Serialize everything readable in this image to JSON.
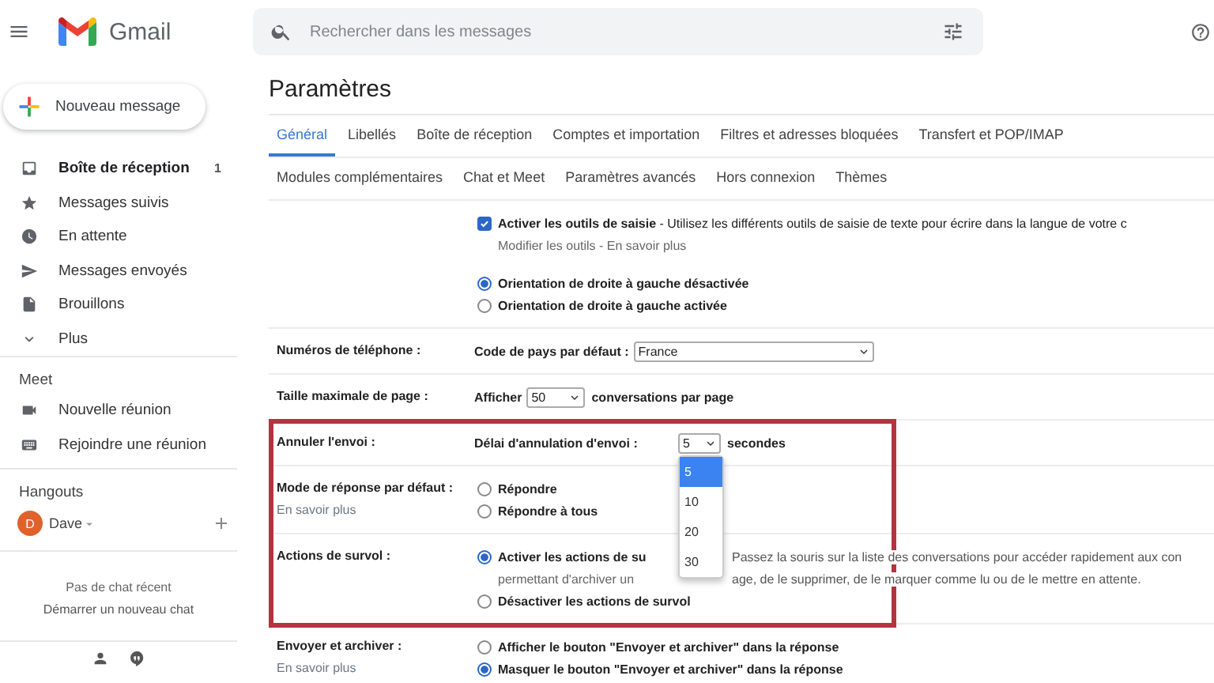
{
  "header": {
    "app_name": "Gmail",
    "search": {
      "placeholder": "Rechercher dans les messages"
    }
  },
  "sidebar": {
    "compose": "Nouveau message",
    "items": [
      {
        "label": "Boîte de réception",
        "count": "1",
        "unread": true
      },
      {
        "label": "Messages suivis",
        "unread": false
      },
      {
        "label": "En attente",
        "unread": false
      },
      {
        "label": "Messages envoyés",
        "unread": false
      },
      {
        "label": "Brouillons",
        "unread": false
      },
      {
        "label": "Plus",
        "unread": false
      }
    ],
    "meet": {
      "title": "Meet",
      "items": [
        "Nouvelle réunion",
        "Rejoindre une réunion"
      ]
    },
    "hangouts": {
      "title": "Hangouts",
      "user": {
        "initial": "D",
        "name": "Dave"
      },
      "empty_text": "Pas de chat récent",
      "start_link": "Démarrer un nouveau chat"
    }
  },
  "settings": {
    "title": "Paramètres",
    "tab_rows": [
      [
        {
          "label": "Général",
          "selected": true
        },
        {
          "label": "Libellés",
          "selected": false
        },
        {
          "label": "Boîte de réception",
          "selected": false
        },
        {
          "label": "Comptes et importation",
          "selected": false
        },
        {
          "label": "Filtres et adresses bloquées",
          "selected": false
        },
        {
          "label": "Transfert et POP/IMAP",
          "selected": false
        }
      ],
      [
        {
          "label": "Modules complémentaires",
          "selected": false
        },
        {
          "label": "Chat et Meet",
          "selected": false
        },
        {
          "label": "Paramètres avancés",
          "selected": false
        },
        {
          "label": "Hors connexion",
          "selected": false
        },
        {
          "label": "Thèmes",
          "selected": false
        }
      ]
    ],
    "sections": [
      {
        "highlighted": false,
        "lines": [
          {
            "kind": "checkbox",
            "checked": true,
            "text": "**Activer les outils de saisie** - Utilisez les différents outils de saisie de texte pour écrire dans la langue de votre c"
          },
          {
            "kind": "note",
            "text": "Modifier les outils - En savoir plus"
          },
          {
            "kind": "radio",
            "selected": true,
            "text": "Orientation de droite à gauche désactivée"
          },
          {
            "kind": "radio",
            "selected": false,
            "text": "Orientation de droite à gauche activée"
          }
        ]
      },
      {
        "label": "Numéros de téléphone :",
        "highlighted": false,
        "lines": [
          {
            "kind": "select",
            "label": "Code de pays par défaut :",
            "value": "France"
          }
        ]
      },
      {
        "label": "Taille maximale de page :",
        "highlighted": false,
        "lines": [
          {
            "kind": "select",
            "label": "Afficher",
            "value": "50",
            "after": "conversations par page"
          }
        ]
      },
      {
        "label": "Annuler l'envoi :",
        "highlighted": true,
        "lines": [
          {
            "kind": "select",
            "label": "Délai d'annulation d'envoi :",
            "value": "5",
            "after": "secondes",
            "expanded": true,
            "options": [
              {
                "label": "5",
                "selected": true
              },
              {
                "label": "10",
                "selected": false
              },
              {
                "label": "20",
                "selected": false
              },
              {
                "label": "30",
                "selected": false
              }
            ]
          }
        ]
      },
      {
        "label": "Mode de réponse par défaut :",
        "link": "En savoir plus",
        "highlighted": true,
        "lines": [
          {
            "kind": "radio",
            "selected": false,
            "text": "Répondre"
          },
          {
            "kind": "radio",
            "selected": false,
            "text": "Répondre à tous"
          }
        ]
      },
      {
        "label": "Actions de survol :",
        "highlighted": true,
        "lines": [
          {
            "kind": "radio",
            "selected": true,
            "text": "Activer les actions de su",
            "text_after": "Passez la souris sur la liste des conversations pour accéder rapidement aux con"
          },
          {
            "kind": "note",
            "text": "permettant d'archiver un",
            "text_after": "age, de le supprimer, de le marquer comme lu ou de le mettre en attente."
          },
          {
            "kind": "radio",
            "selected": false,
            "text": "Désactiver les actions de survol"
          }
        ]
      },
      {
        "label": "Envoyer et archiver :",
        "link": "En savoir plus",
        "highlighted": false,
        "lines": [
          {
            "kind": "radio",
            "selected": false,
            "text": "Afficher le bouton \"Envoyer et archiver\" dans la réponse"
          },
          {
            "kind": "radio",
            "selected": true,
            "text": "Masquer le bouton \"Envoyer et archiver\" dans la réponse"
          }
        ]
      }
    ]
  }
}
